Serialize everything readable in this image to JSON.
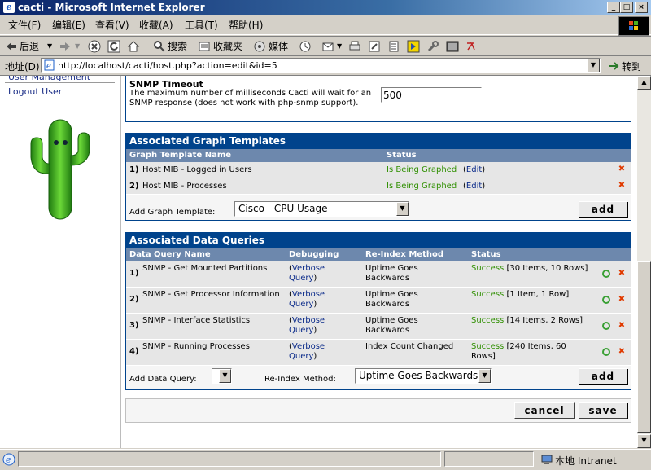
{
  "window": {
    "title": "cacti - Microsoft Internet Explorer",
    "controls": [
      "_",
      "□",
      "×"
    ]
  },
  "menu": [
    "文件(F)",
    "编辑(E)",
    "查看(V)",
    "收藏(A)",
    "工具(T)",
    "帮助(H)"
  ],
  "toolbar": {
    "back": "后退",
    "search": "搜索",
    "favorites": "收藏夹",
    "media": "媒体"
  },
  "address": {
    "label": "地址(D)",
    "url": "http://localhost/cacti/host.php?action=edit&id=5",
    "go": "转到"
  },
  "sidebar": {
    "partial_link": "User Management",
    "logout": "Logout User"
  },
  "snmp": {
    "title": "SNMP Timeout",
    "description": "The maximum number of milliseconds Cacti will wait for an SNMP response (does not work with php-snmp support).",
    "value": "500"
  },
  "graph_templates": {
    "title": "Associated Graph Templates",
    "columns": [
      "Graph Template Name",
      "Status"
    ],
    "rows": [
      {
        "num": "1)",
        "name": "Host MIB - Logged in Users",
        "status": "Is Being Graphed",
        "edit": "Edit"
      },
      {
        "num": "2)",
        "name": "Host MIB - Processes",
        "status": "Is Being Graphed",
        "edit": "Edit"
      }
    ],
    "add_label": "Add Graph Template:",
    "add_value": "Cisco - CPU Usage",
    "add_button": "add"
  },
  "data_queries": {
    "title": "Associated Data Queries",
    "columns": [
      "Data Query Name",
      "Debugging",
      "Re-Index Method",
      "Status"
    ],
    "rows": [
      {
        "num": "1)",
        "name": "SNMP - Get Mounted Partitions",
        "debug": "Verbose Query",
        "reindex": "Uptime Goes Backwards",
        "status": "Success",
        "detail": "[30 Items, 10 Rows]"
      },
      {
        "num": "2)",
        "name": "SNMP - Get Processor Information",
        "debug": "Verbose Query",
        "reindex": "Uptime Goes Backwards",
        "status": "Success",
        "detail": "[1 Item, 1 Row]"
      },
      {
        "num": "3)",
        "name": "SNMP - Interface Statistics",
        "debug": "Verbose Query",
        "reindex": "Uptime Goes Backwards",
        "status": "Success",
        "detail": "[14 Items, 2 Rows]"
      },
      {
        "num": "4)",
        "name": "SNMP - Running Processes",
        "debug": "Verbose Query",
        "reindex": "Index Count Changed",
        "status": "Success",
        "detail": "[240 Items, 60 Rows]"
      }
    ],
    "add_label": "Add Data Query:",
    "reindex_label": "Re-Index Method:",
    "reindex_value": "Uptime Goes Backwards",
    "add_button": "add"
  },
  "actions": {
    "cancel": "cancel",
    "save": "save"
  },
  "status": {
    "zone": "本地 Intranet"
  },
  "colors": {
    "header": "#00438c",
    "colhead": "#6d88ad",
    "success": "#2f8f00",
    "delete": "#e03a00"
  }
}
